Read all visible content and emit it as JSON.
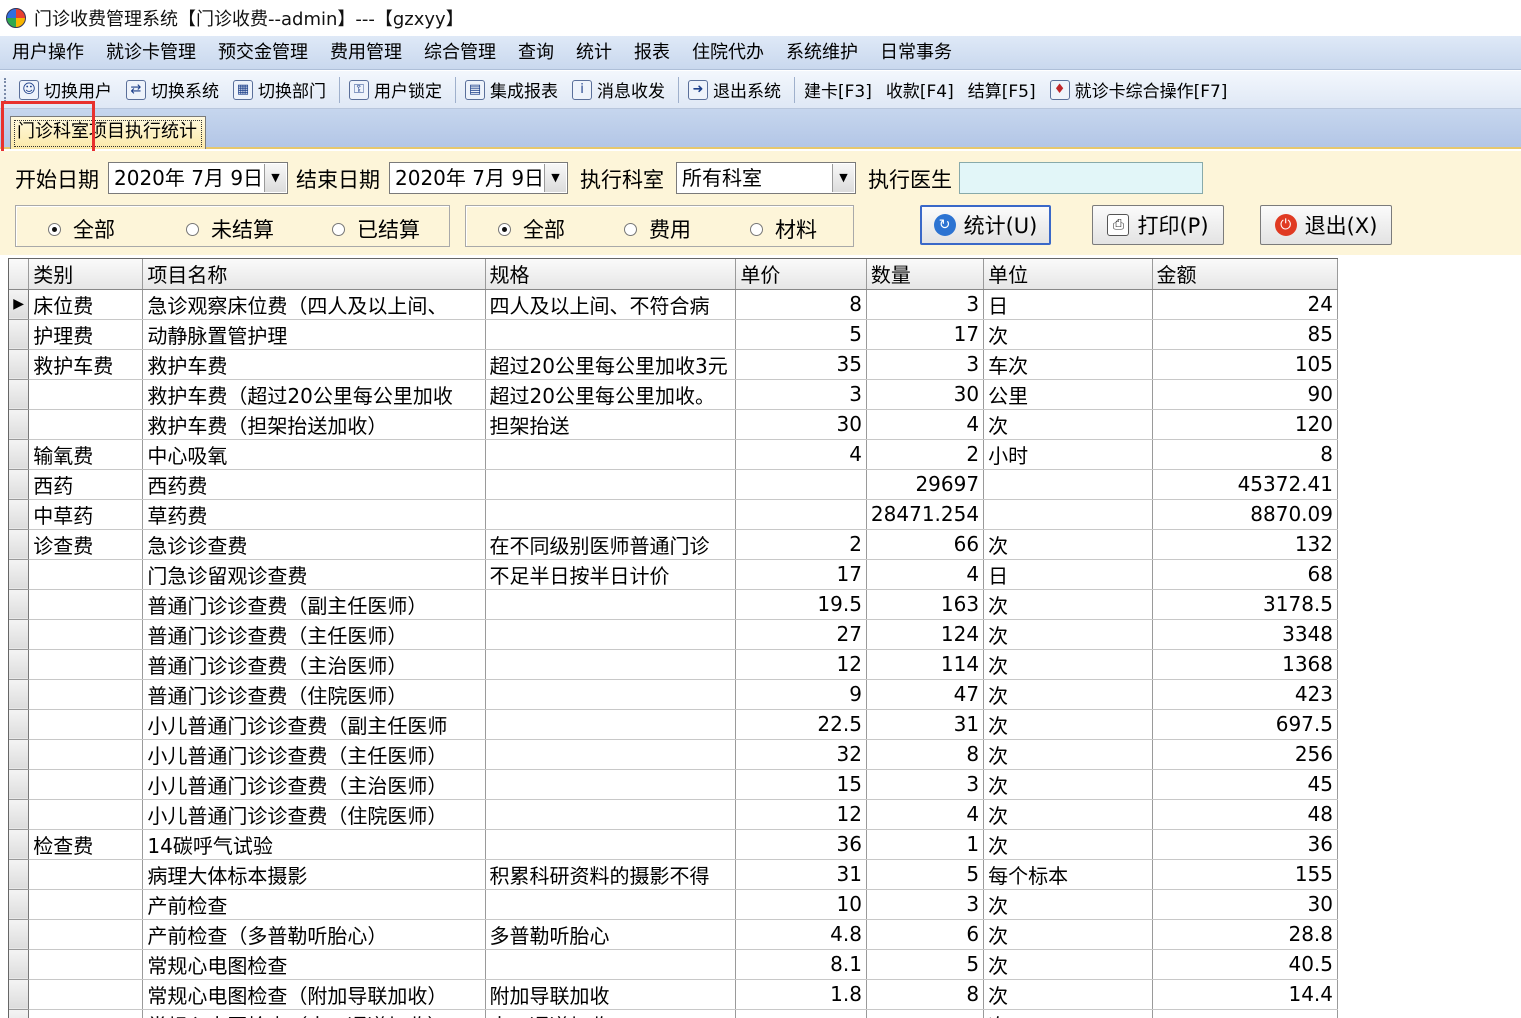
{
  "window": {
    "title": "门诊收费管理系统【门诊收费--admin】---【gzxyy】"
  },
  "menu": [
    "用户操作",
    "就诊卡管理",
    "预交金管理",
    "费用管理",
    "综合管理",
    "查询",
    "统计",
    "报表",
    "住院代办",
    "系统维护",
    "日常事务"
  ],
  "toolbar": {
    "switch_user": "切换用户",
    "switch_system": "切换系统",
    "switch_dept": "切换部门",
    "user_lock": "用户锁定",
    "integrated_report": "集成报表",
    "message": "消息收发",
    "exit_system": "退出系统",
    "new_card": "建卡[F3]",
    "collect": "收款[F4]",
    "settle": "结算[F5]",
    "card_ops": "就诊卡综合操作[F7]"
  },
  "tab": {
    "label": "门诊科室项目执行统计"
  },
  "filters": {
    "start_label": "开始日期",
    "start_value": "2020年  7月  9日",
    "end_label": "结束日期",
    "end_value": "2020年  7月  9日",
    "dept_label": "执行科室",
    "dept_value": "所有科室",
    "doctor_label": "执行医生",
    "doctor_value": ""
  },
  "settle_filter": {
    "all": "全部",
    "unsettled": "未结算",
    "settled": "已结算",
    "selected": "all"
  },
  "type_filter": {
    "all": "全部",
    "fee": "费用",
    "material": "材料",
    "selected": "all"
  },
  "buttons": {
    "stats": "统计(U)",
    "print": "打印(P)",
    "exit": "退出(X)"
  },
  "grid": {
    "columns": [
      "类别",
      "项目名称",
      "规格",
      "单价",
      "数量",
      "单位",
      "金额"
    ],
    "rows": [
      [
        "床位费",
        "急诊观察床位费（四人及以上间、",
        "四人及以上间、不符合病",
        "8",
        "3",
        "日",
        "24"
      ],
      [
        "护理费",
        "动静脉置管护理",
        "",
        "5",
        "17",
        "次",
        "85"
      ],
      [
        "救护车费",
        "救护车费",
        "超过20公里每公里加收3元",
        "35",
        "3",
        "车次",
        "105"
      ],
      [
        "",
        "救护车费（超过20公里每公里加收",
        "超过20公里每公里加收。",
        "3",
        "30",
        "公里",
        "90"
      ],
      [
        "",
        "救护车费（担架抬送加收）",
        "担架抬送",
        "30",
        "4",
        "次",
        "120"
      ],
      [
        "输氧费",
        "中心吸氧",
        "",
        "4",
        "2",
        "小时",
        "8"
      ],
      [
        "西药",
        "西药费",
        "",
        "",
        "29697",
        "",
        "45372.41"
      ],
      [
        "中草药",
        "草药费",
        "",
        "",
        "28471.254",
        "",
        "8870.09"
      ],
      [
        "诊查费",
        "急诊诊查费",
        "在不同级别医师普通门诊",
        "2",
        "66",
        "次",
        "132"
      ],
      [
        "",
        "门急诊留观诊查费",
        "不足半日按半日计价",
        "17",
        "4",
        "日",
        "68"
      ],
      [
        "",
        "普通门诊诊查费（副主任医师）",
        "",
        "19.5",
        "163",
        "次",
        "3178.5"
      ],
      [
        "",
        "普通门诊诊查费（主任医师）",
        "",
        "27",
        "124",
        "次",
        "3348"
      ],
      [
        "",
        "普通门诊诊查费（主治医师）",
        "",
        "12",
        "114",
        "次",
        "1368"
      ],
      [
        "",
        "普通门诊诊查费（住院医师）",
        "",
        "9",
        "47",
        "次",
        "423"
      ],
      [
        "",
        "小儿普通门诊诊查费（副主任医师",
        "",
        "22.5",
        "31",
        "次",
        "697.5"
      ],
      [
        "",
        "小儿普通门诊诊查费（主任医师）",
        "",
        "32",
        "8",
        "次",
        "256"
      ],
      [
        "",
        "小儿普通门诊诊查费（主治医师）",
        "",
        "15",
        "3",
        "次",
        "45"
      ],
      [
        "",
        "小儿普通门诊诊查费（住院医师）",
        "",
        "12",
        "4",
        "次",
        "48"
      ],
      [
        "检查费",
        "14碳呼气试验",
        "",
        "36",
        "1",
        "次",
        "36"
      ],
      [
        "",
        "病理大体标本摄影",
        "积累科研资料的摄影不得",
        "31",
        "5",
        "每个标本",
        "155"
      ],
      [
        "",
        "产前检查",
        "",
        "10",
        "3",
        "次",
        "30"
      ],
      [
        "",
        "产前检查（多普勒听胎心）",
        "多普勒听胎心",
        "4.8",
        "6",
        "次",
        "28.8"
      ],
      [
        "",
        "常规心电图检查",
        "",
        "8.1",
        "5",
        "次",
        "40.5"
      ],
      [
        "",
        "常规心电图检查（附加导联加收）",
        "附加导联加收",
        "1.8",
        "8",
        "次",
        "14.4"
      ],
      [
        "",
        "常规心电图检查（十二通道加收）",
        "十二通道加收",
        "",
        "",
        "次",
        ""
      ]
    ]
  }
}
